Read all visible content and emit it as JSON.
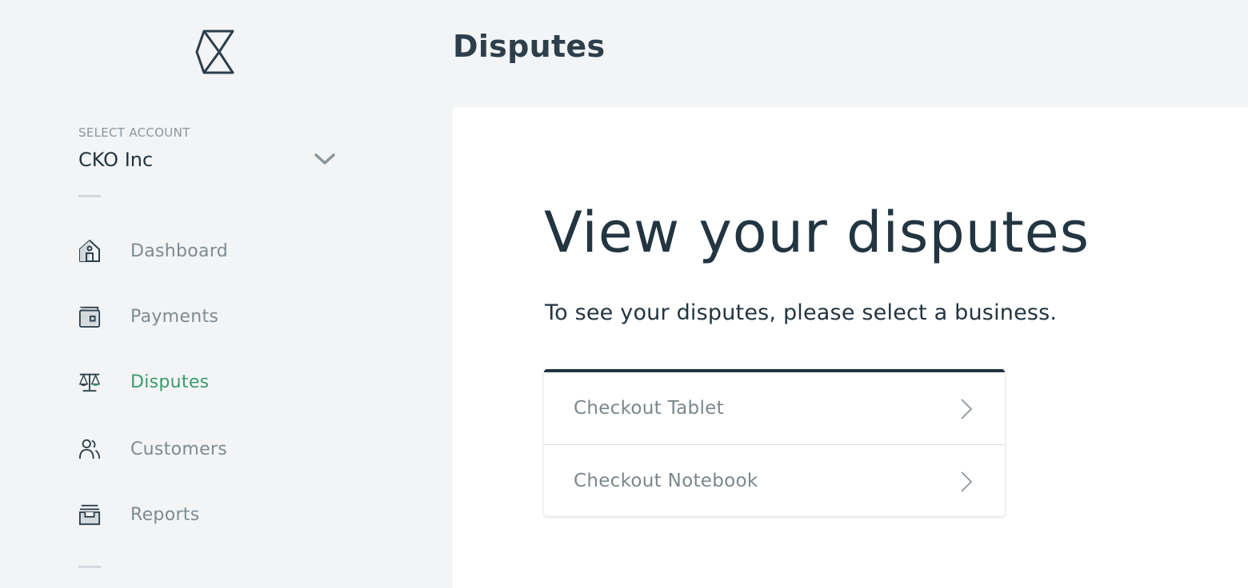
{
  "header": {
    "title": "Disputes"
  },
  "sidebar": {
    "account": {
      "label": "SELECT ACCOUNT",
      "name": "CKO Inc"
    },
    "nav": [
      {
        "label": "Dashboard",
        "icon": "home-icon",
        "active": false
      },
      {
        "label": "Payments",
        "icon": "wallet-icon",
        "active": false
      },
      {
        "label": "Disputes",
        "icon": "scales-icon",
        "active": true
      },
      {
        "label": "Customers",
        "icon": "users-icon",
        "active": false
      },
      {
        "label": "Reports",
        "icon": "archive-icon",
        "active": false
      }
    ]
  },
  "main": {
    "heading": "View your disputes",
    "subheading": "To see your disputes, please select a business.",
    "businesses": [
      {
        "label": "Checkout Tablet"
      },
      {
        "label": "Checkout Notebook"
      }
    ]
  },
  "colors": {
    "accent": "#3c9a6a",
    "text": "#223541",
    "muted": "#7e8b93",
    "background": "#f2f4f6"
  }
}
